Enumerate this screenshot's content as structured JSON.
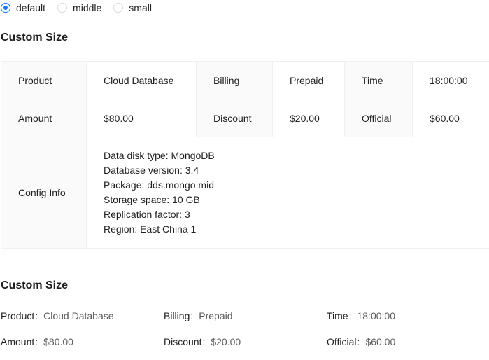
{
  "size_options": [
    {
      "label": "default",
      "checked": true
    },
    {
      "label": "middle",
      "checked": false
    },
    {
      "label": "small",
      "checked": false
    }
  ],
  "bordered_section": {
    "title": "Custom Size",
    "items": {
      "product": {
        "label": "Product",
        "value": "Cloud Database"
      },
      "billing": {
        "label": "Billing",
        "value": "Prepaid"
      },
      "time": {
        "label": "Time",
        "value": "18:00:00"
      },
      "amount": {
        "label": "Amount",
        "value": "$80.00"
      },
      "discount": {
        "label": "Discount",
        "value": "$20.00"
      },
      "official": {
        "label": "Official",
        "value": "$60.00"
      },
      "config": {
        "label": "Config Info",
        "lines": [
          "Data disk type: MongoDB",
          "Database version: 3.4",
          "Package: dds.mongo.mid",
          "Storage space: 10 GB",
          "Replication factor: 3",
          "Region: East China 1"
        ]
      }
    }
  },
  "plain_section": {
    "title": "Custom Size",
    "colon": ":",
    "items": {
      "product": {
        "label": "Product",
        "value": "Cloud Database"
      },
      "billing": {
        "label": "Billing",
        "value": "Prepaid"
      },
      "time": {
        "label": "Time",
        "value": "18:00:00"
      },
      "amount": {
        "label": "Amount",
        "value": "$80.00"
      },
      "discount": {
        "label": "Discount",
        "value": "$20.00"
      },
      "official": {
        "label": "Official",
        "value": "$60.00"
      }
    }
  },
  "colors": {
    "accent": "#1677ff",
    "border": "#f0f0f0",
    "label_bg": "#fafafa"
  }
}
